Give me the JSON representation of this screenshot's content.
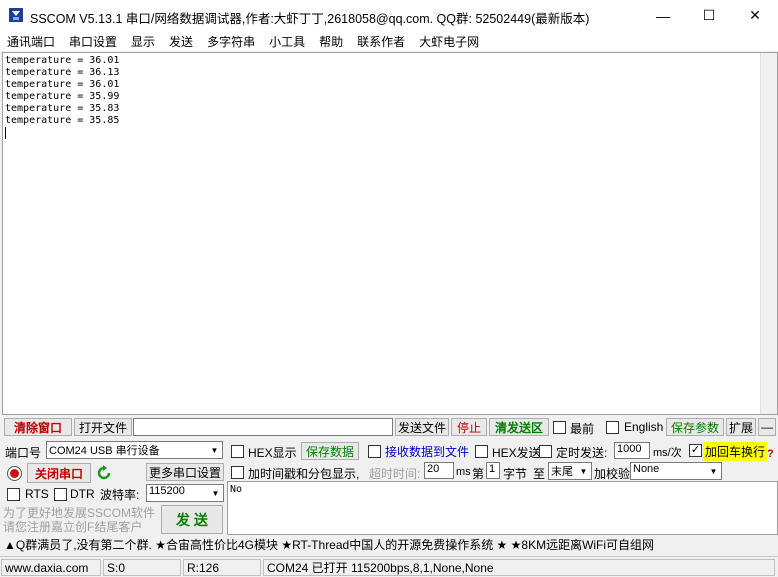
{
  "window": {
    "title": "SSCOM V5.13.1 串口/网络数据调试器,作者:大虾丁丁,2618058@qq.com. QQ群: 52502449(最新版本)",
    "icon": "sscom-app-icon",
    "minimize": "—",
    "maximize": "☐",
    "close": "✕"
  },
  "menu": [
    "通讯端口",
    "串口设置",
    "显示",
    "发送",
    "多字符串",
    "小工具",
    "帮助",
    "联系作者",
    "大虾电子网"
  ],
  "receive": {
    "lines": [
      "temperature = 36.01",
      "temperature = 36.13",
      "temperature = 36.01",
      "temperature = 35.99",
      "temperature = 35.83",
      "temperature = 35.85"
    ]
  },
  "toolbar": {
    "clear_window": "清除窗口",
    "open_file": "打开文件",
    "file_path": "",
    "send_file": "发送文件",
    "stop": "停止",
    "clear_send_area": "清发送区",
    "topmost": "最前",
    "english": "English",
    "save_params": "保存参数",
    "expand": "扩展",
    "collapse": "—"
  },
  "port": {
    "port_label": "端口号",
    "port_value": "COM24 USB 串行设备",
    "close_port": "关闭串口",
    "more_settings": "更多串口设置",
    "rts": "RTS",
    "dtr": "DTR",
    "baud_label": "波特率:",
    "baud_value": "115200"
  },
  "options": {
    "hex_display": "HEX显示",
    "save_data": "保存数据",
    "recv_to_file": "接收数据到文件",
    "hex_send": "HEX发送",
    "timed_send": "定时发送:",
    "interval_value": "1000",
    "interval_unit": "ms/次",
    "add_crlf": "加回车换行",
    "help_mark": "?",
    "timestamp": "加时间戳和分包显示,",
    "timeout_label": "超时时间:",
    "timeout_value": "20",
    "timeout_unit": "ms",
    "byte_prefix": "第",
    "byte_index": "1",
    "byte_word": "字节",
    "to_word": "至",
    "end_value": "末尾",
    "checksum_label": "加校验",
    "checksum_value": "None"
  },
  "send": {
    "text": "No",
    "send_button": "发 送"
  },
  "promo": {
    "line1": "为了更好地发展SSCOM软件",
    "line2": "请您注册嘉立创F结尾客户"
  },
  "ticker": "▲Q群满员了,没有第二个群. ★合宙高性价比4G模块 ★RT-Thread中国人的开源免费操作系统 ★ ★8KM远距离WiFi可自组网",
  "status": {
    "website": "www.daxia.com",
    "sent": "S:0",
    "received": "R:126",
    "port_state": "COM24 已打开  115200bps,8,1,None,None"
  },
  "colors": {
    "accent_red": "#c00000",
    "accent_green": "#008000",
    "highlight_yellow": "#ffff00"
  }
}
